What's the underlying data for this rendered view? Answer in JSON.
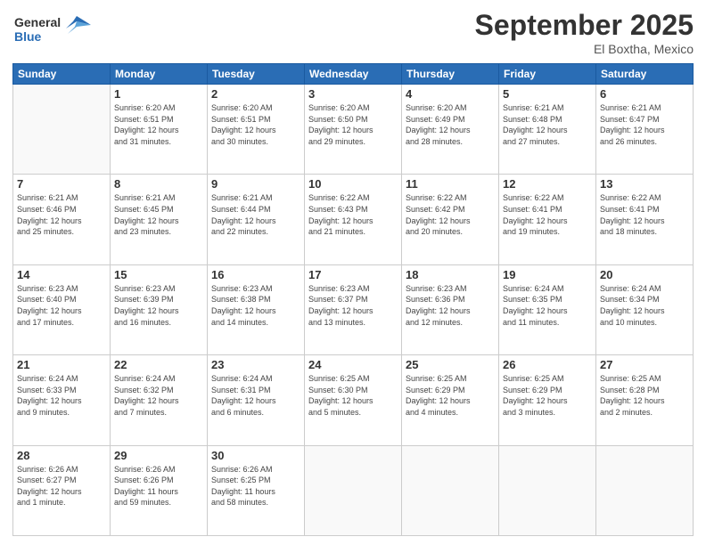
{
  "logo": {
    "line1": "General",
    "line2": "Blue"
  },
  "header": {
    "month": "September 2025",
    "location": "El Boxtha, Mexico"
  },
  "days_of_week": [
    "Sunday",
    "Monday",
    "Tuesday",
    "Wednesday",
    "Thursday",
    "Friday",
    "Saturday"
  ],
  "weeks": [
    [
      {
        "day": "",
        "info": ""
      },
      {
        "day": "1",
        "info": "Sunrise: 6:20 AM\nSunset: 6:51 PM\nDaylight: 12 hours\nand 31 minutes."
      },
      {
        "day": "2",
        "info": "Sunrise: 6:20 AM\nSunset: 6:51 PM\nDaylight: 12 hours\nand 30 minutes."
      },
      {
        "day": "3",
        "info": "Sunrise: 6:20 AM\nSunset: 6:50 PM\nDaylight: 12 hours\nand 29 minutes."
      },
      {
        "day": "4",
        "info": "Sunrise: 6:20 AM\nSunset: 6:49 PM\nDaylight: 12 hours\nand 28 minutes."
      },
      {
        "day": "5",
        "info": "Sunrise: 6:21 AM\nSunset: 6:48 PM\nDaylight: 12 hours\nand 27 minutes."
      },
      {
        "day": "6",
        "info": "Sunrise: 6:21 AM\nSunset: 6:47 PM\nDaylight: 12 hours\nand 26 minutes."
      }
    ],
    [
      {
        "day": "7",
        "info": "Sunrise: 6:21 AM\nSunset: 6:46 PM\nDaylight: 12 hours\nand 25 minutes."
      },
      {
        "day": "8",
        "info": "Sunrise: 6:21 AM\nSunset: 6:45 PM\nDaylight: 12 hours\nand 23 minutes."
      },
      {
        "day": "9",
        "info": "Sunrise: 6:21 AM\nSunset: 6:44 PM\nDaylight: 12 hours\nand 22 minutes."
      },
      {
        "day": "10",
        "info": "Sunrise: 6:22 AM\nSunset: 6:43 PM\nDaylight: 12 hours\nand 21 minutes."
      },
      {
        "day": "11",
        "info": "Sunrise: 6:22 AM\nSunset: 6:42 PM\nDaylight: 12 hours\nand 20 minutes."
      },
      {
        "day": "12",
        "info": "Sunrise: 6:22 AM\nSunset: 6:41 PM\nDaylight: 12 hours\nand 19 minutes."
      },
      {
        "day": "13",
        "info": "Sunrise: 6:22 AM\nSunset: 6:41 PM\nDaylight: 12 hours\nand 18 minutes."
      }
    ],
    [
      {
        "day": "14",
        "info": "Sunrise: 6:23 AM\nSunset: 6:40 PM\nDaylight: 12 hours\nand 17 minutes."
      },
      {
        "day": "15",
        "info": "Sunrise: 6:23 AM\nSunset: 6:39 PM\nDaylight: 12 hours\nand 16 minutes."
      },
      {
        "day": "16",
        "info": "Sunrise: 6:23 AM\nSunset: 6:38 PM\nDaylight: 12 hours\nand 14 minutes."
      },
      {
        "day": "17",
        "info": "Sunrise: 6:23 AM\nSunset: 6:37 PM\nDaylight: 12 hours\nand 13 minutes."
      },
      {
        "day": "18",
        "info": "Sunrise: 6:23 AM\nSunset: 6:36 PM\nDaylight: 12 hours\nand 12 minutes."
      },
      {
        "day": "19",
        "info": "Sunrise: 6:24 AM\nSunset: 6:35 PM\nDaylight: 12 hours\nand 11 minutes."
      },
      {
        "day": "20",
        "info": "Sunrise: 6:24 AM\nSunset: 6:34 PM\nDaylight: 12 hours\nand 10 minutes."
      }
    ],
    [
      {
        "day": "21",
        "info": "Sunrise: 6:24 AM\nSunset: 6:33 PM\nDaylight: 12 hours\nand 9 minutes."
      },
      {
        "day": "22",
        "info": "Sunrise: 6:24 AM\nSunset: 6:32 PM\nDaylight: 12 hours\nand 7 minutes."
      },
      {
        "day": "23",
        "info": "Sunrise: 6:24 AM\nSunset: 6:31 PM\nDaylight: 12 hours\nand 6 minutes."
      },
      {
        "day": "24",
        "info": "Sunrise: 6:25 AM\nSunset: 6:30 PM\nDaylight: 12 hours\nand 5 minutes."
      },
      {
        "day": "25",
        "info": "Sunrise: 6:25 AM\nSunset: 6:29 PM\nDaylight: 12 hours\nand 4 minutes."
      },
      {
        "day": "26",
        "info": "Sunrise: 6:25 AM\nSunset: 6:29 PM\nDaylight: 12 hours\nand 3 minutes."
      },
      {
        "day": "27",
        "info": "Sunrise: 6:25 AM\nSunset: 6:28 PM\nDaylight: 12 hours\nand 2 minutes."
      }
    ],
    [
      {
        "day": "28",
        "info": "Sunrise: 6:26 AM\nSunset: 6:27 PM\nDaylight: 12 hours\nand 1 minute."
      },
      {
        "day": "29",
        "info": "Sunrise: 6:26 AM\nSunset: 6:26 PM\nDaylight: 11 hours\nand 59 minutes."
      },
      {
        "day": "30",
        "info": "Sunrise: 6:26 AM\nSunset: 6:25 PM\nDaylight: 11 hours\nand 58 minutes."
      },
      {
        "day": "",
        "info": ""
      },
      {
        "day": "",
        "info": ""
      },
      {
        "day": "",
        "info": ""
      },
      {
        "day": "",
        "info": ""
      }
    ]
  ]
}
